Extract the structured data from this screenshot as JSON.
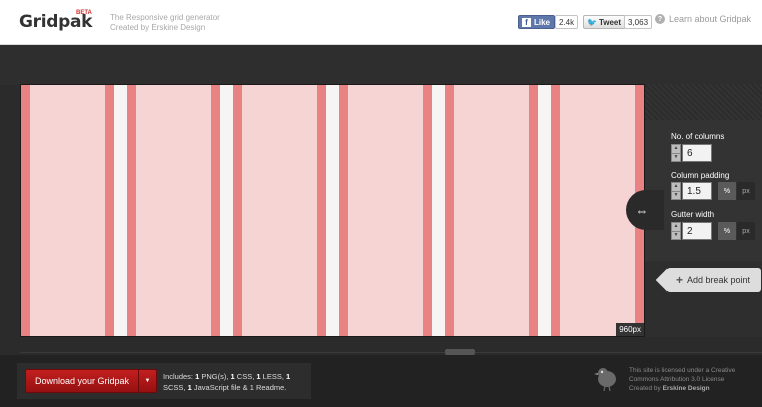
{
  "header": {
    "logo": "Gridpak",
    "beta": "BETA",
    "tagline_line1": "The Responsive grid generator",
    "tagline_line2": "Created by Erskine Design",
    "fb_like_label": "Like",
    "fb_count": "2.4k",
    "tweet_label": "Tweet",
    "tweet_count": "3,063",
    "learn_about": "Learn about Gridpak"
  },
  "preview": {
    "width_label": "960px",
    "columns": 6,
    "padding_percent": 1.5,
    "gutter_percent": 2
  },
  "controls": {
    "columns_label": "No. of columns",
    "columns_value": "6",
    "padding_label": "Column padding",
    "padding_value": "1.5",
    "gutter_label": "Gutter width",
    "gutter_value": "2",
    "unit_percent": "%",
    "unit_px": "px",
    "add_breakpoint": "Add break point"
  },
  "footer": {
    "download_label": "Download your Gridpak",
    "includes": {
      "prefix": "Includes: ",
      "n1": "1",
      "t1": " PNG(s), ",
      "n2": "1",
      "t2": " CSS, ",
      "n3": "1",
      "t3": " LESS, ",
      "n4": "1",
      "t4": " SCSS, ",
      "n5": "1",
      "t5": " JavaScript file & 1 Readme."
    },
    "license_line1": "This site is licensed under a Creative",
    "license_line2": "Commons Attribution 3.0 License",
    "license_created": "Created by ",
    "license_author": "Erskine Design"
  },
  "colors": {
    "column_padding": "#e98282",
    "column_content": "#f6d4d4",
    "gutter": "#f7f4f4",
    "download_red": "#b51818"
  },
  "icons": {
    "drag_handle": "resize-horizontal-icon",
    "add_breakpoint": "plus-icon",
    "learn_about": "question-icon",
    "mascot": "bird-mascot-icon"
  }
}
